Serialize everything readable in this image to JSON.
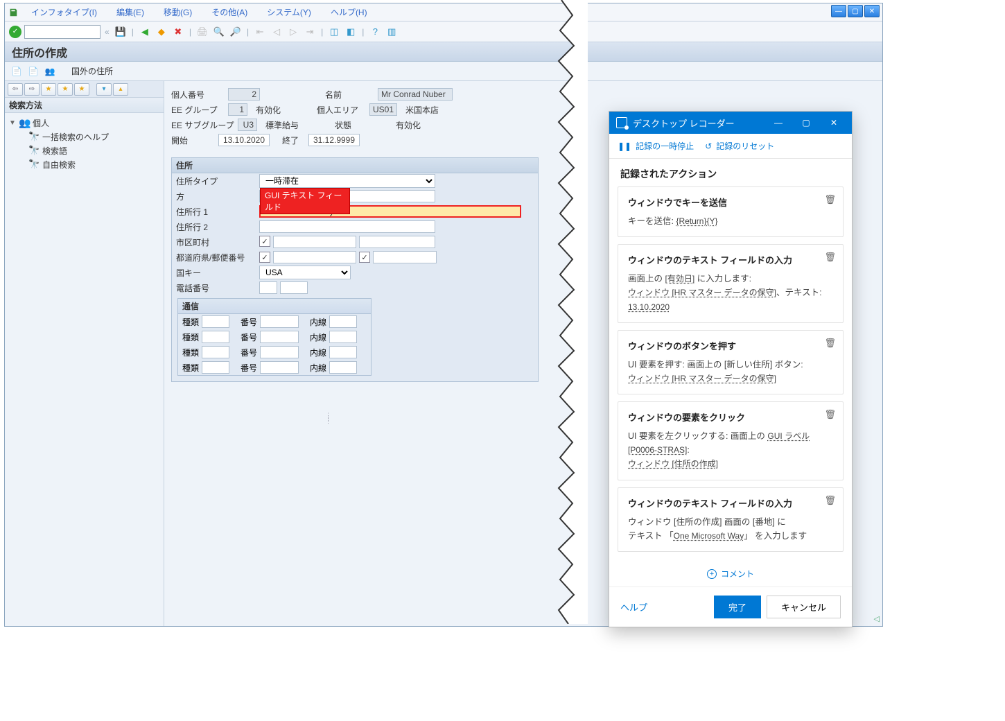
{
  "sap": {
    "menu": [
      "インフォタイプ(I)",
      "編集(E)",
      "移動(G)",
      "その他(A)",
      "システム(Y)",
      "ヘルプ(H)"
    ],
    "title": "住所の作成",
    "subtoolbar_text": "国外の住所",
    "left": {
      "header": "検索方法",
      "root": "個人",
      "items": [
        "一括検索のヘルプ",
        "検索語",
        "自由検索"
      ]
    },
    "info": {
      "personnel_no_label": "個人番号",
      "personnel_no": "2",
      "name_label": "名前",
      "name": "Mr Conrad Nuber",
      "ee_group_label": "EE グループ",
      "ee_group": "1",
      "ee_group_text": "有効化",
      "personnel_area_label": "個人エリア",
      "personnel_area": "US01",
      "personnel_area_text": "米国本店",
      "ee_subgroup_label": "EE サブグループ",
      "ee_subgroup": "U3",
      "ee_subgroup_text": "標準給与",
      "status_label": "状態",
      "status_text": "有効化",
      "start_label": "開始",
      "start": "13.10.2020",
      "end_label": "終了",
      "end": "31.12.9999"
    },
    "address": {
      "panel": "住所",
      "type_label": "住所タイプ",
      "type_value": "一時滞在",
      "co_label": "方",
      "line1_label": "住所行 1",
      "line1_value": "One Microsoft Way",
      "line2_label": "住所行 2",
      "city_label": "市区町村",
      "state_zip_label": "都道府県/郵便番号",
      "country_label": "国キー",
      "country_value": "USA",
      "phone_label": "電話番号",
      "highlight_tag": "GUI テキスト フィールド"
    },
    "comm": {
      "panel": "通信",
      "type": "種類",
      "number": "番号",
      "ext": "内線"
    }
  },
  "recorder": {
    "title": "デスクトップ レコーダー",
    "pause": "記録の一時停止",
    "reset": "記録のリセット",
    "section": "記録されたアクション",
    "actions": [
      {
        "title": "ウィンドウでキーを送信",
        "lines": [
          [
            "キーを送信: ",
            "{Return}{Y}"
          ]
        ]
      },
      {
        "title": "ウィンドウのテキスト フィールドの入力",
        "lines": [
          [
            "画面上の ",
            "[有効日]",
            " に入力します:"
          ],
          [
            "",
            "ウィンドウ [HR マスター データの保守]",
            "、テキスト: ",
            "13.10.2020"
          ]
        ]
      },
      {
        "title": "ウィンドウのボタンを押す",
        "lines": [
          [
            "UI 要素を押す: 画面上の [新しい住所] ボタン: "
          ],
          [
            "",
            "ウィンドウ [HR マスター データの保守]"
          ]
        ]
      },
      {
        "title": "ウィンドウの要素をクリック",
        "lines": [
          [
            "UI 要素を左クリックする: 画面上の ",
            "GUI ラベル [P0006-STRAS]",
            ": "
          ],
          [
            "",
            "ウィンドウ [住所の作成]"
          ]
        ]
      },
      {
        "title": "ウィンドウのテキスト フィールドの入力",
        "lines": [
          [
            "ウィンドウ [住所の作成] 画面の [番地] に"
          ],
          [
            "テキスト 「",
            "One Microsoft Way",
            "」 を入力します"
          ]
        ]
      }
    ],
    "add_comment": "コメント",
    "help": "ヘルプ",
    "done": "完了",
    "cancel": "キャンセル"
  }
}
